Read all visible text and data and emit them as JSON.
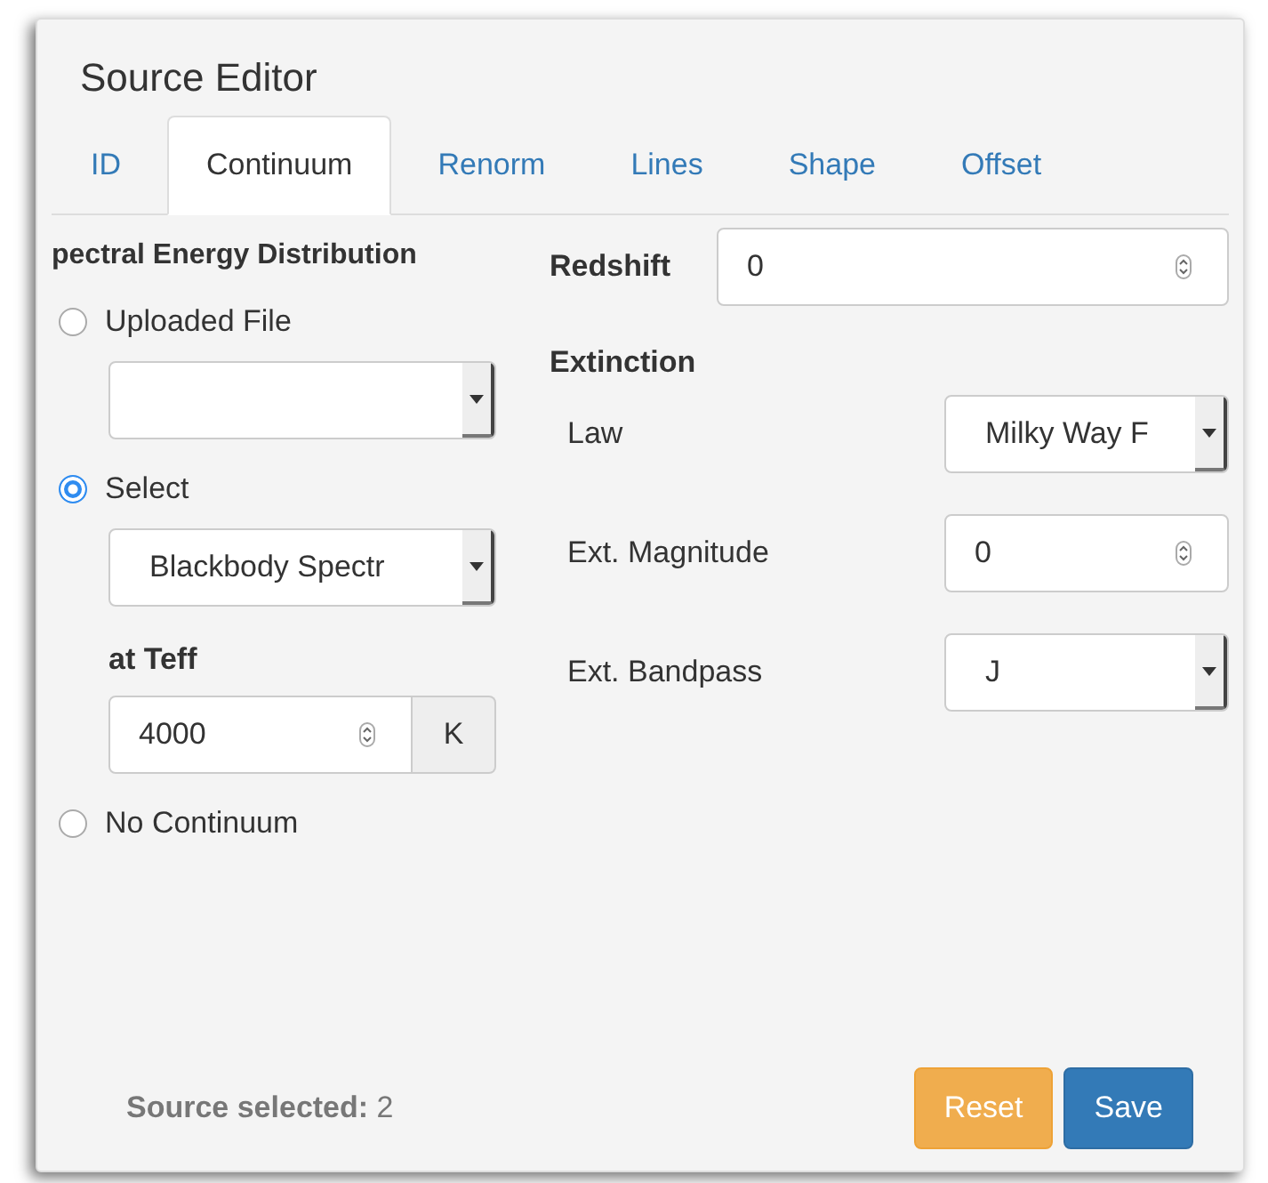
{
  "window": {
    "title": "Source Editor"
  },
  "tabs": [
    {
      "label": "ID",
      "selected": false
    },
    {
      "label": "Continuum",
      "selected": true
    },
    {
      "label": "Renorm",
      "selected": false
    },
    {
      "label": "Lines",
      "selected": false
    },
    {
      "label": "Shape",
      "selected": false
    },
    {
      "label": "Offset",
      "selected": false
    }
  ],
  "sed": {
    "heading": "pectral Energy Distribution",
    "options": [
      {
        "label": "Uploaded File",
        "selected": false,
        "kind": "dropdown"
      },
      {
        "label": "Select",
        "selected": true,
        "kind": "dropdown",
        "value": "Blackbody Spectr",
        "teff": {
          "label": "at Teff",
          "value": "4000",
          "unit": "K"
        }
      },
      {
        "label": "No Continuum",
        "selected": false,
        "kind": "none"
      }
    ]
  },
  "redshift": {
    "label": "Redshift",
    "value": "0"
  },
  "extinction": {
    "heading": "Extinction",
    "fields": [
      {
        "label": "Law",
        "kind": "select",
        "value": "Milky Way F"
      },
      {
        "label": "Ext. Magnitude",
        "kind": "number",
        "value": "0"
      },
      {
        "label": "Ext. Bandpass",
        "kind": "select",
        "value": "J"
      }
    ]
  },
  "status": "**Source selected:** 2",
  "buttons": [
    {
      "label": "Reset",
      "kind": "warning"
    },
    {
      "label": "Save",
      "kind": "primary"
    }
  ]
}
